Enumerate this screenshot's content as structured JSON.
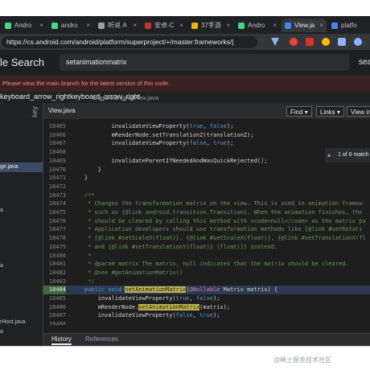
{
  "browser": {
    "tabs": [
      {
        "label": "Andro",
        "active": false,
        "fav": "#3ddc84"
      },
      {
        "label": "andro",
        "active": false,
        "fav": "#3ddc84"
      },
      {
        "label": "听说 A",
        "active": false,
        "fav": "#9aa0a6"
      },
      {
        "label": "安卓-C",
        "active": false,
        "fav": "#c0392b"
      },
      {
        "label": "37手游",
        "active": false,
        "fav": "#f4b400"
      },
      {
        "label": "Andro",
        "active": false,
        "fav": "#3ddc84"
      },
      {
        "label": "View.ja",
        "active": true,
        "fav": "#4285f4"
      },
      {
        "label": "platfo",
        "active": false,
        "fav": "#4285f4"
      }
    ],
    "tab_close": "×",
    "url": "https://cs.android.com/android/platform/superproject/+/master:frameworks/|"
  },
  "header": {
    "title": "le Search",
    "search_value": "setanimationmatrix",
    "right_text": "sea"
  },
  "banner": {
    "text": "Please view the main branch for the latest version of this code."
  },
  "breadcrumb": {
    "left": "keyboard_arrow_rightkeyboard_arrow_right",
    "path": "a/android/view/View.java"
  },
  "sidebar": {
    "header_label": "key",
    "items": [
      {
        "label": "ge.java",
        "selected": true
      },
      {
        "label": "",
        "selected": false
      },
      {
        "label": "a",
        "selected": false
      },
      {
        "label": "",
        "selected": false
      },
      {
        "label": "a",
        "selected": false
      },
      {
        "label": "",
        "selected": false
      },
      {
        "label": "rHost.java",
        "selected": false
      },
      {
        "label": "a",
        "selected": false
      }
    ]
  },
  "file": {
    "name": "View.java",
    "find_label": "Find ▾",
    "links_label": "Links ▾",
    "view_label": "View in",
    "match_count": "1 of 6 match"
  },
  "code_lines": [
    {
      "n": "18465",
      "t": "            invalidateViewProperty(true, false);"
    },
    {
      "n": "18466",
      "t": "            mRenderNode.setTranslationZ(translationZ);"
    },
    {
      "n": "18467",
      "t": "            invalidateViewProperty(false, true);"
    },
    {
      "n": "18468",
      "t": ""
    },
    {
      "n": "18469",
      "t": "            invalidateParentIfNeededAndWasQuickRejected();"
    },
    {
      "n": "18470",
      "t": "        }"
    },
    {
      "n": "18471",
      "t": "    }"
    },
    {
      "n": "18472",
      "t": ""
    },
    {
      "n": "18473",
      "t": "    /**"
    },
    {
      "n": "18474",
      "t": "     * Changes the transformation matrix on the view. This is used in animation framew"
    },
    {
      "n": "18475",
      "t": "     * such as {@link android.transition.Transition}. When the animation finishes, the"
    },
    {
      "n": "18476",
      "t": "     * should be cleared by calling this method with <code>null</code> as the matrix pa"
    },
    {
      "n": "18477",
      "t": "     * Application developers should use transformation methods like {@link #setRotati"
    },
    {
      "n": "18478",
      "t": "     * {@link #setScaleX(float)}, {@link #setScaleX(float)}, {@link #setTranslationX(fl"
    },
    {
      "n": "18479",
      "t": "     * and {@link #setTranslationY(float)} (float)}} instead."
    },
    {
      "n": "18480",
      "t": "     *"
    },
    {
      "n": "18481",
      "t": "     * @param matrix The matrix, null indicates that the matrix should be cleared."
    },
    {
      "n": "18482",
      "t": "     * @see #getAnimationMatrix()"
    },
    {
      "n": "18483",
      "t": "     */"
    },
    {
      "n": "18484",
      "t": "    public void setAnimationMatrix(@Nullable Matrix matrix) {"
    },
    {
      "n": "18485",
      "t": "        invalidateViewProperty(true, false);"
    },
    {
      "n": "18486",
      "t": "        mRenderNode.setAnimationMatrix(matrix);"
    },
    {
      "n": "18487",
      "t": "        invalidateViewProperty(false, true);"
    },
    {
      "n": "18488",
      "t": ""
    },
    {
      "n": "18489",
      "t": "        invalidateParentIfNeededAndWasQuickRejected();"
    }
  ],
  "bottom_tabs": [
    {
      "label": "History",
      "active": true
    },
    {
      "label": "References",
      "active": false
    }
  ],
  "watermark": "@稀土掘金技术社区",
  "colors": {
    "banner_text": "#f28b82",
    "match_highlight": "#bdb24a",
    "current_line": "#2c3950"
  }
}
